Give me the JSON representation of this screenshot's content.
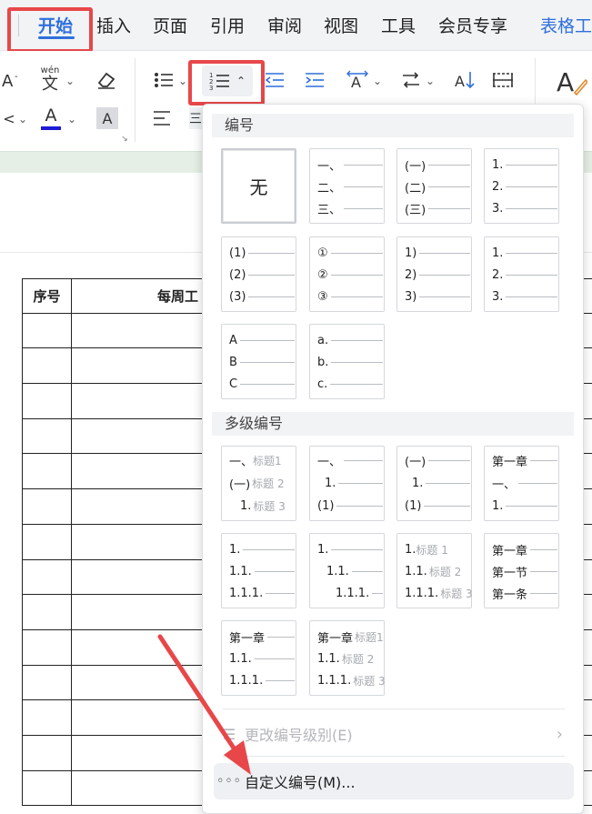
{
  "tabs": {
    "home": "开始",
    "insert": "插入",
    "layout": "页面",
    "references": "引用",
    "review": "审阅",
    "view": "视图",
    "tools": "工具",
    "member": "会员专享",
    "table_tools": "表格工"
  },
  "toolbar": {
    "pinyin_label": "wén",
    "pinyin_char": "文",
    "font_color_letter": "A",
    "char_shade_letter": "A",
    "clear_icon": "eraser-icon",
    "accent_red": "#e8474a",
    "accent_blue": "#2f6fdc"
  },
  "table": {
    "headers": [
      "序号",
      "每周工"
    ],
    "row_count": 14
  },
  "numbering_panel": {
    "section_numbering": "编号",
    "section_multilevel": "多级编号",
    "none_label": "无",
    "single": [
      {
        "id": "cn-comma",
        "rows": [
          "一、",
          "二、",
          "三、"
        ]
      },
      {
        "id": "cn-paren",
        "rows": [
          "(一)",
          "(二)",
          "(三)"
        ]
      },
      {
        "id": "arabic-dot",
        "rows": [
          "1.",
          "2.",
          "3."
        ]
      },
      {
        "id": "paren-arabic",
        "rows": [
          "(1)",
          "(2)",
          "(3)"
        ]
      },
      {
        "id": "circled",
        "rows": [
          "①",
          "②",
          "③"
        ]
      },
      {
        "id": "right-paren",
        "rows": [
          "1)",
          "2)",
          "3)"
        ]
      },
      {
        "id": "arabic-dot-2",
        "rows": [
          "1.",
          "2.",
          "3."
        ]
      },
      {
        "id": "upper-alpha",
        "rows": [
          "A",
          "B",
          "C"
        ]
      },
      {
        "id": "lower-alpha",
        "rows": [
          "a.",
          "b.",
          "c."
        ]
      }
    ],
    "multilevel": [
      {
        "id": "ml-cn-heading",
        "rows": [
          [
            "一、",
            "标题1"
          ],
          [
            "(一)",
            "标题 2"
          ],
          [
            "1.",
            "标题 3"
          ]
        ]
      },
      {
        "id": "ml-cn-plain",
        "rows": [
          [
            "一、",
            ""
          ],
          [
            "1.",
            ""
          ],
          [
            "(1)",
            ""
          ]
        ]
      },
      {
        "id": "ml-paren",
        "rows": [
          [
            "(一)",
            ""
          ],
          [
            "1.",
            ""
          ],
          [
            "(1)",
            ""
          ]
        ]
      },
      {
        "id": "ml-chapter",
        "rows": [
          [
            "第一章",
            ""
          ],
          [
            "一、",
            ""
          ],
          [
            "1.",
            ""
          ]
        ]
      },
      {
        "id": "ml-decimal",
        "rows": [
          [
            "1.",
            ""
          ],
          [
            "1.1.",
            ""
          ],
          [
            "1.1.1.",
            ""
          ]
        ]
      },
      {
        "id": "ml-decimal-indent",
        "rows": [
          [
            "1.",
            ""
          ],
          [
            "1.1.",
            ""
          ],
          [
            "1.1.1.",
            ""
          ]
        ]
      },
      {
        "id": "ml-decimal-heading",
        "rows": [
          [
            "1.",
            "标题 1"
          ],
          [
            "1.1.",
            "标题 2"
          ],
          [
            "1.1.1.",
            "标题 3"
          ]
        ]
      },
      {
        "id": "ml-chapter-section",
        "rows": [
          [
            "第一章",
            ""
          ],
          [
            "第一节",
            ""
          ],
          [
            "第一条",
            ""
          ]
        ]
      },
      {
        "id": "ml-chapter-decimal",
        "rows": [
          [
            "第一章",
            ""
          ],
          [
            "1.1.",
            ""
          ],
          [
            "1.1.1.",
            ""
          ]
        ]
      },
      {
        "id": "ml-chapter-heading",
        "rows": [
          [
            "第一章",
            "标题1"
          ],
          [
            "1.1.",
            "标题 2"
          ],
          [
            "1.1.1.",
            "标题 3"
          ]
        ]
      }
    ],
    "change_level": "更改编号级别(E)",
    "custom_numbering": "自定义编号(M)..."
  }
}
